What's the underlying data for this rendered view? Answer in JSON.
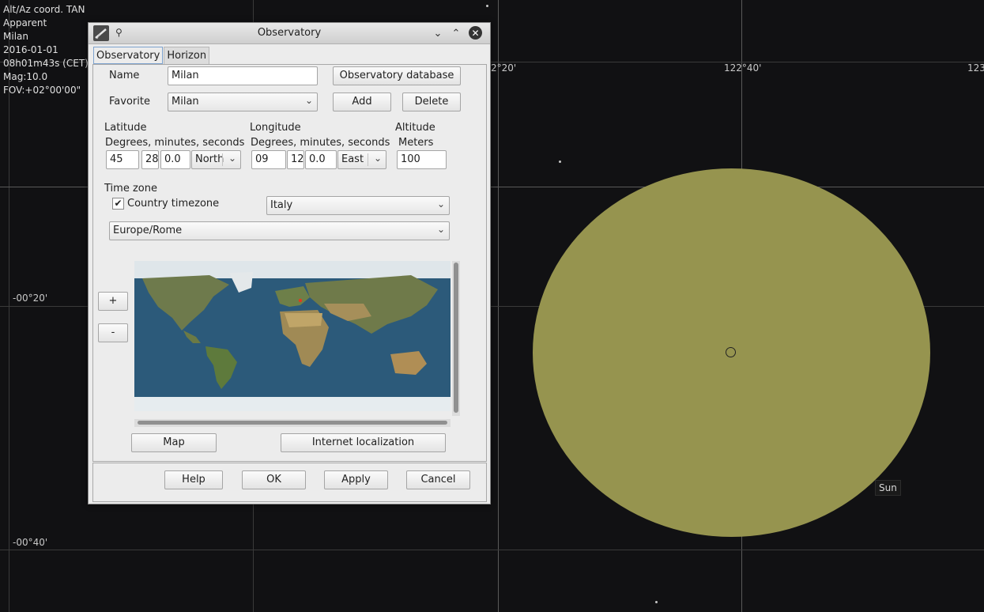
{
  "sky": {
    "info_lines": [
      "Alt/Az coord. TAN",
      "Apparent",
      "Milan",
      "2016-01-01",
      "08h01m43s (CET)",
      "Mag:10.0",
      "FOV:+02°00'00\""
    ],
    "coord_labels": {
      "ra_1": "2°20'",
      "ra_2": "122°40'",
      "ra_3": "123",
      "dec_1": "-00°20'",
      "dec_2": "-00°40'"
    },
    "sun_label": "Sun",
    "colors": {
      "background": "#111113",
      "sun": "#96944f"
    }
  },
  "dialog": {
    "title": "Observatory",
    "tabs": [
      "Observatory",
      "Horizon"
    ],
    "active_tab": "Observatory",
    "name_label": "Name",
    "name_value": "Milan",
    "observatory_db_button": "Observatory database",
    "favorite_label": "Favorite",
    "favorite_value": "Milan",
    "add_button": "Add",
    "delete_button": "Delete",
    "latitude": {
      "label": "Latitude",
      "sub": "Degrees, minutes, seconds",
      "deg": "45",
      "min": "28",
      "sec": "0.0",
      "hemisphere": "North"
    },
    "longitude": {
      "label": "Longitude",
      "sub": "Degrees, minutes, seconds",
      "deg": "09",
      "min": "12",
      "sec": "0.0",
      "hemisphere": "East"
    },
    "altitude": {
      "label": "Altitude",
      "sub": "Meters",
      "value": "100"
    },
    "timezone_label": "Time zone",
    "country_timezone_label": "Country timezone",
    "country_timezone_checked": true,
    "country_value": "Italy",
    "zone_value": "Europe/Rome",
    "zoom_in": "+",
    "zoom_out": "-",
    "map_button": "Map",
    "internet_localization_button": "Internet localization",
    "help_button": "Help",
    "ok_button": "OK",
    "apply_button": "Apply",
    "cancel_button": "Cancel"
  }
}
